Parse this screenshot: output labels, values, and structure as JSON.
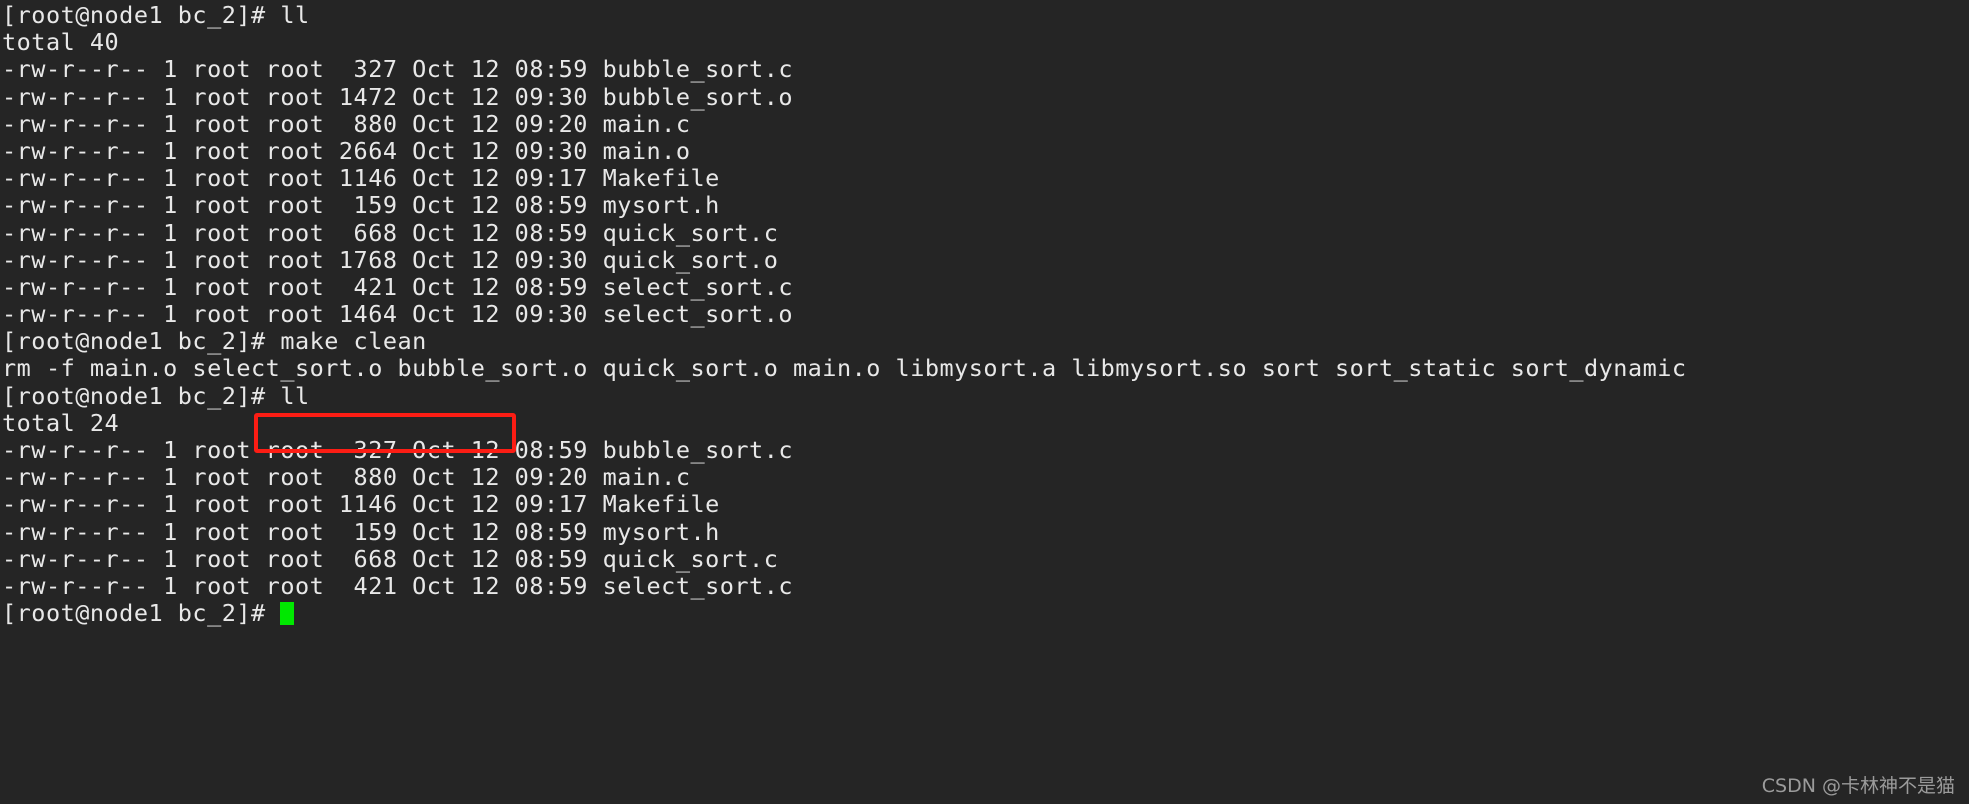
{
  "terminal": {
    "background_color": "#252525",
    "foreground_color": "#e8e8e8",
    "cursor_color": "#00e800",
    "highlight_color": "#fc1d14",
    "lines": [
      {
        "id": "prompt-ll-1",
        "text": "[root@node1 bc_2]# ll"
      },
      {
        "id": "total-40",
        "text": "total 40"
      },
      {
        "id": "file-bubble-sort-c",
        "text": "-rw-r--r-- 1 root root  327 Oct 12 08:59 bubble_sort.c"
      },
      {
        "id": "file-bubble-sort-o",
        "text": "-rw-r--r-- 1 root root 1472 Oct 12 09:30 bubble_sort.o"
      },
      {
        "id": "file-main-c",
        "text": "-rw-r--r-- 1 root root  880 Oct 12 09:20 main.c"
      },
      {
        "id": "file-main-o",
        "text": "-rw-r--r-- 1 root root 2664 Oct 12 09:30 main.o"
      },
      {
        "id": "file-makefile",
        "text": "-rw-r--r-- 1 root root 1146 Oct 12 09:17 Makefile"
      },
      {
        "id": "file-mysort-h",
        "text": "-rw-r--r-- 1 root root  159 Oct 12 08:59 mysort.h"
      },
      {
        "id": "file-quick-sort-c",
        "text": "-rw-r--r-- 1 root root  668 Oct 12 08:59 quick_sort.c"
      },
      {
        "id": "file-quick-sort-o",
        "text": "-rw-r--r-- 1 root root 1768 Oct 12 09:30 quick_sort.o"
      },
      {
        "id": "file-select-sort-c",
        "text": "-rw-r--r-- 1 root root  421 Oct 12 08:59 select_sort.c"
      },
      {
        "id": "file-select-sort-o",
        "text": "-rw-r--r-- 1 root root 1464 Oct 12 09:30 select_sort.o"
      },
      {
        "id": "prompt-make-clean",
        "text": "[root@node1 bc_2]# make clean"
      },
      {
        "id": "rm-output",
        "text": "rm -f main.o select_sort.o bubble_sort.o quick_sort.o main.o libmysort.a libmysort.so sort sort_static sort_dynamic"
      },
      {
        "id": "prompt-ll-2",
        "text": "[root@node1 bc_2]# ll"
      },
      {
        "id": "total-24",
        "text": "total 24"
      },
      {
        "id": "file2-bubble-sort-c",
        "text": "-rw-r--r-- 1 root root  327 Oct 12 08:59 bubble_sort.c"
      },
      {
        "id": "file2-main-c",
        "text": "-rw-r--r-- 1 root root  880 Oct 12 09:20 main.c"
      },
      {
        "id": "file2-makefile",
        "text": "-rw-r--r-- 1 root root 1146 Oct 12 09:17 Makefile"
      },
      {
        "id": "file2-mysort-h",
        "text": "-rw-r--r-- 1 root root  159 Oct 12 08:59 mysort.h"
      },
      {
        "id": "file2-quick-sort-c",
        "text": "-rw-r--r-- 1 root root  668 Oct 12 08:59 quick_sort.c"
      },
      {
        "id": "file2-select-sort-c",
        "text": "-rw-r--r-- 1 root root  421 Oct 12 08:59 select_sort.c"
      }
    ],
    "final_prompt": "[root@node1 bc_2]# ",
    "highlighted_command": "make clean"
  },
  "watermark": {
    "text": "CSDN @卡林神不是猫"
  }
}
